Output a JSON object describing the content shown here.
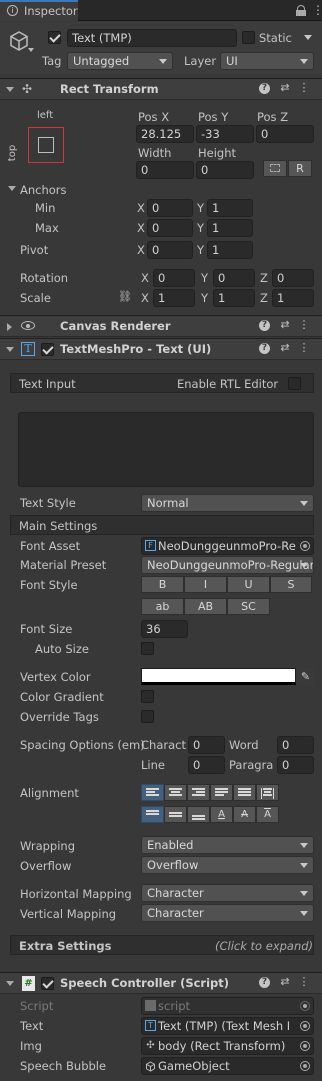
{
  "tab": {
    "title": "Inspector"
  },
  "object": {
    "name": "Text (TMP)",
    "static_label": "Static",
    "tag_label": "Tag",
    "tag_value": "Untagged",
    "layer_label": "Layer",
    "layer_value": "UI"
  },
  "rect_transform": {
    "title": "Rect Transform",
    "anchor_h": "left",
    "anchor_v": "top",
    "pos_x_label": "Pos X",
    "pos_y_label": "Pos Y",
    "pos_z_label": "Pos Z",
    "pos_x": "28.125",
    "pos_y": "-33",
    "pos_z": "0",
    "width_label": "Width",
    "height_label": "Height",
    "width": "0",
    "height": "0",
    "raw_label": "R",
    "anchors_label": "Anchors",
    "min_label": "Min",
    "max_label": "Max",
    "pivot_label": "Pivot",
    "min_x": "0",
    "min_y": "1",
    "max_x": "0",
    "max_y": "1",
    "pivot_x": "0",
    "pivot_y": "1",
    "x_label": "X",
    "y_label": "Y",
    "z_label": "Z",
    "rotation_label": "Rotation",
    "scale_label": "Scale",
    "rot_x": "0",
    "rot_y": "0",
    "rot_z": "0",
    "scale_x": "1",
    "scale_y": "1",
    "scale_z": "1"
  },
  "canvas_renderer": {
    "title": "Canvas Renderer"
  },
  "tmp": {
    "title": "TextMeshPro - Text (UI)",
    "text_input_label": "Text Input",
    "rtl_label": "Enable RTL Editor",
    "text_value": "",
    "text_style_label": "Text Style",
    "text_style_value": "Normal",
    "main_settings_label": "Main Settings",
    "font_asset_label": "Font Asset",
    "font_asset_value": "NeoDunggeunmoPro-Re",
    "material_preset_label": "Material Preset",
    "material_preset_value": "NeoDunggeunmoPro-Regular",
    "font_style_label": "Font Style",
    "style_buttons": [
      "B",
      "I",
      "U",
      "S",
      "ab",
      "AB",
      "SC"
    ],
    "font_size_label": "Font Size",
    "font_size_value": "36",
    "auto_size_label": "Auto Size",
    "vertex_color_label": "Vertex Color",
    "vertex_color": "#ffffff",
    "color_gradient_label": "Color Gradient",
    "override_tags_label": "Override Tags",
    "spacing_label": "Spacing Options (em)",
    "character_label": "Charact",
    "character_value": "0",
    "word_label": "Word",
    "word_value": "0",
    "line_label": "Line",
    "line_value": "0",
    "paragraph_label": "Paragra",
    "paragraph_value": "0",
    "alignment_label": "Alignment",
    "wrapping_label": "Wrapping",
    "wrapping_value": "Enabled",
    "overflow_label": "Overflow",
    "overflow_value": "Overflow",
    "hmap_label": "Horizontal Mapping",
    "hmap_value": "Character",
    "vmap_label": "Vertical Mapping",
    "vmap_value": "Character",
    "extra_label": "Extra Settings",
    "extra_hint": "(Click to expand)"
  },
  "speech": {
    "title": "Speech Controller (Script)",
    "script_label": "Script",
    "script_value": "script",
    "text_label": "Text",
    "text_value": "Text (TMP) (Text Mesh I",
    "img_label": "Img",
    "img_value": "body (Rect Transform)",
    "bubble_label": "Speech Bubble",
    "bubble_value": "GameObject"
  },
  "colors": {
    "accent": "#46607c",
    "background": "#383838",
    "header": "#3e3e3e"
  }
}
